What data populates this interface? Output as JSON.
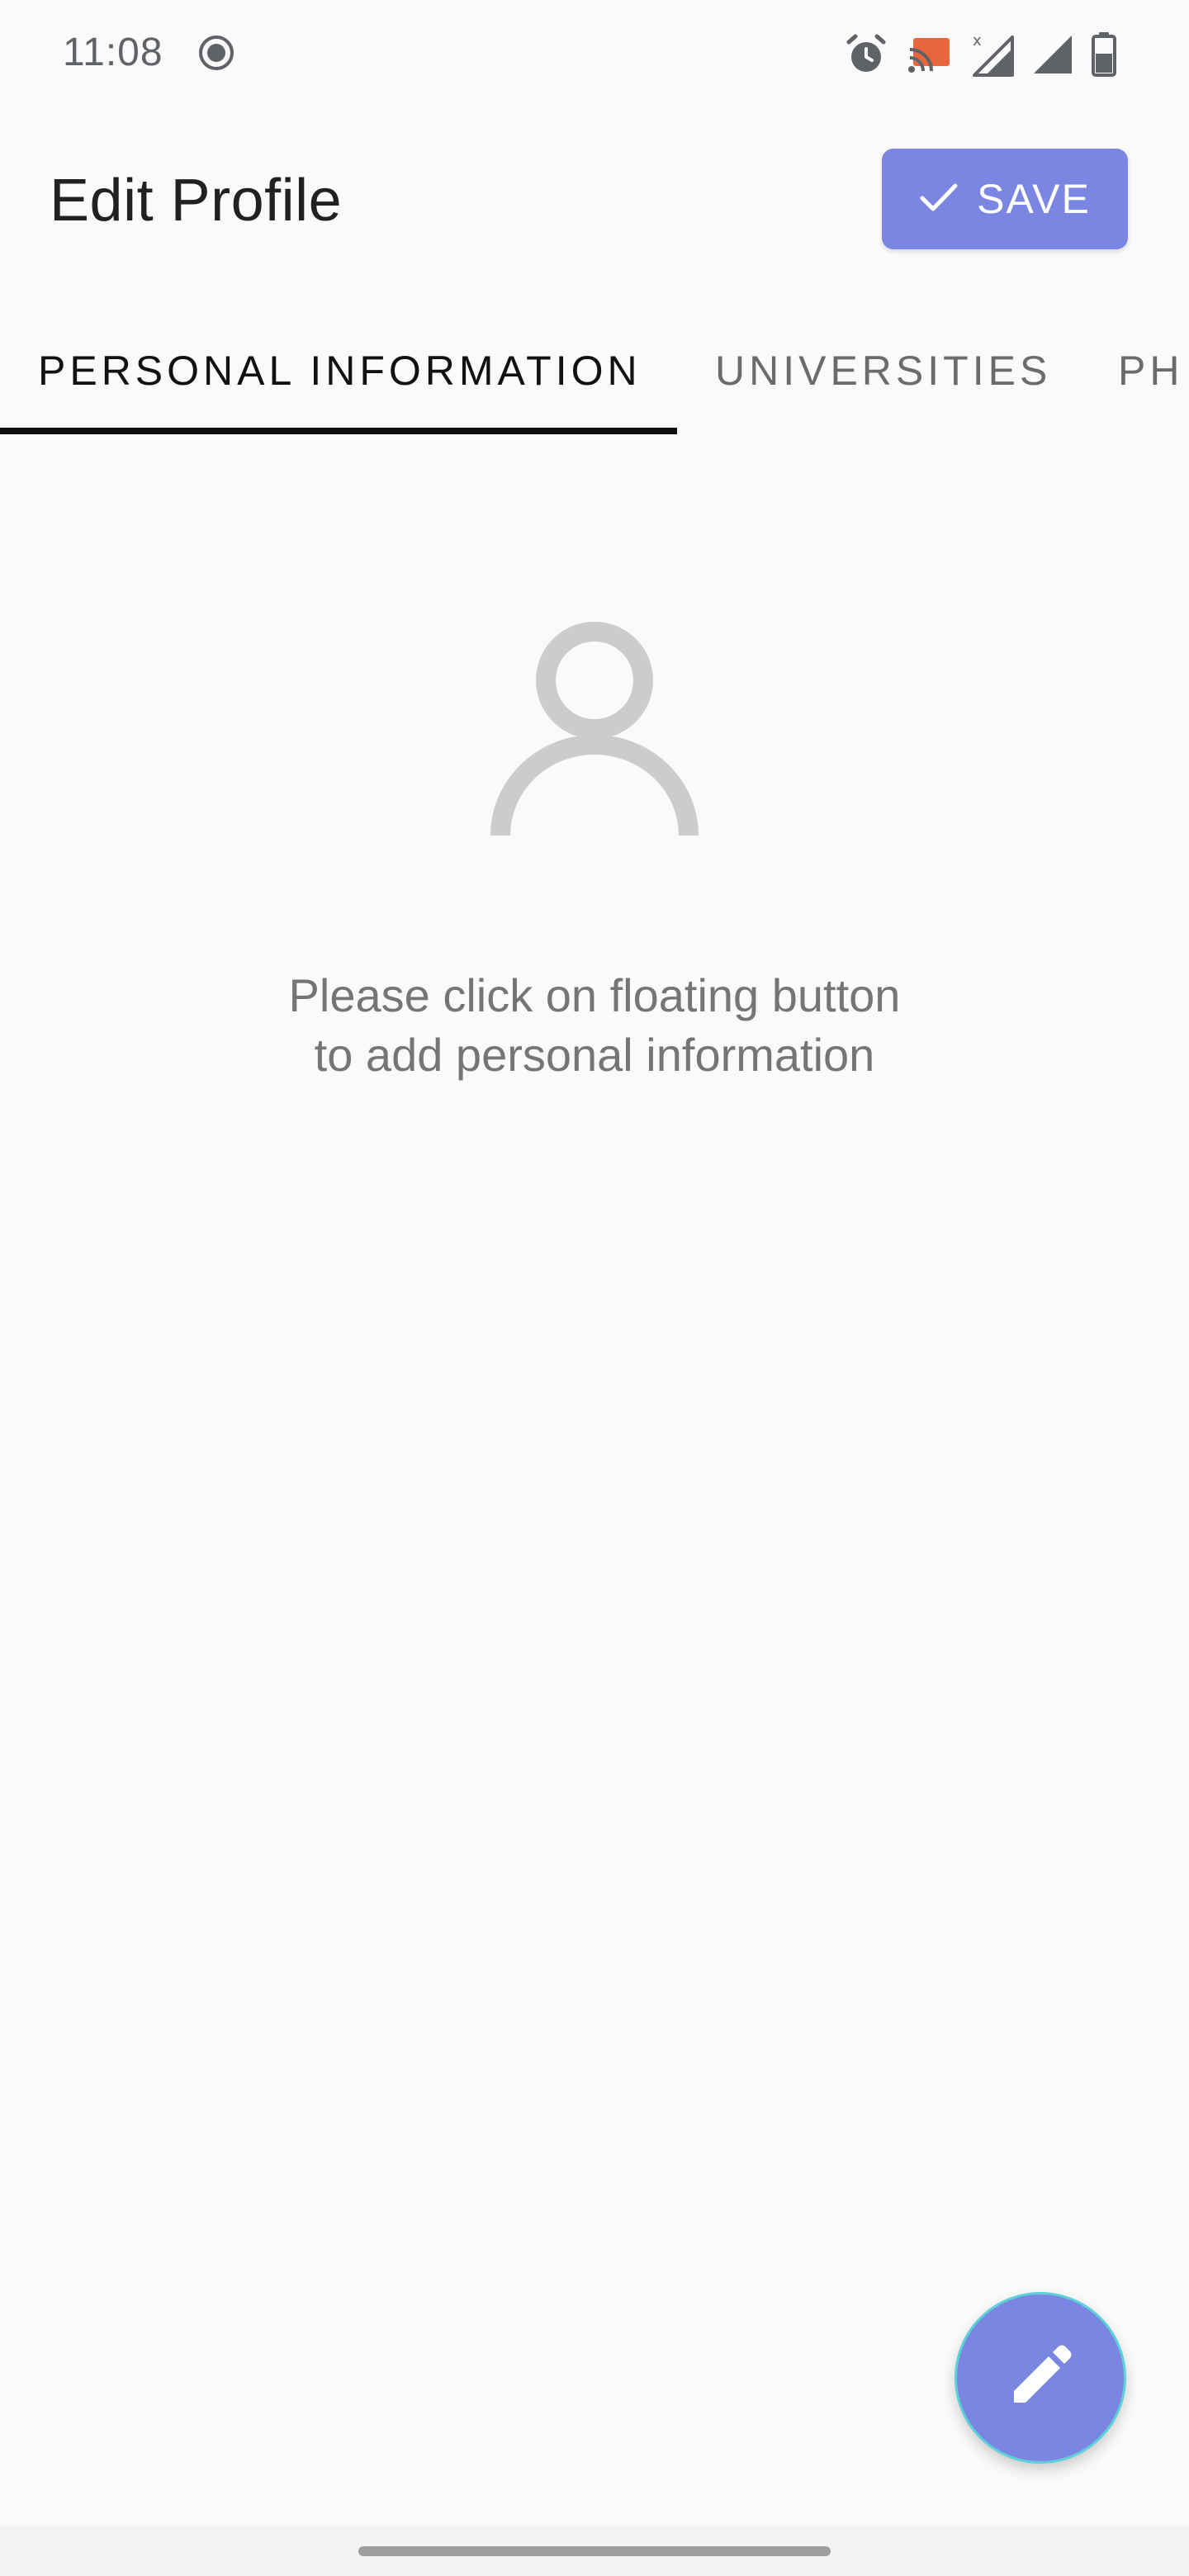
{
  "status_bar": {
    "time": "11:08",
    "icons": [
      "record-icon",
      "alarm-icon",
      "cast-icon",
      "signal-no-data-icon",
      "signal-icon",
      "battery-icon"
    ],
    "cast_color": "#e8663d"
  },
  "header": {
    "title": "Edit Profile",
    "save_label": "SAVE",
    "save_icon": "check-icon",
    "accent_color": "#7b86e2"
  },
  "tabs": [
    {
      "label": "PERSONAL INFORMATION",
      "active": true
    },
    {
      "label": "UNIVERSITIES",
      "active": false
    },
    {
      "label": "PH",
      "active": false
    }
  ],
  "empty_state": {
    "icon": "person-icon",
    "line1": "Please click on floating button",
    "line2": "to add personal information"
  },
  "fab": {
    "icon": "pencil-icon"
  }
}
